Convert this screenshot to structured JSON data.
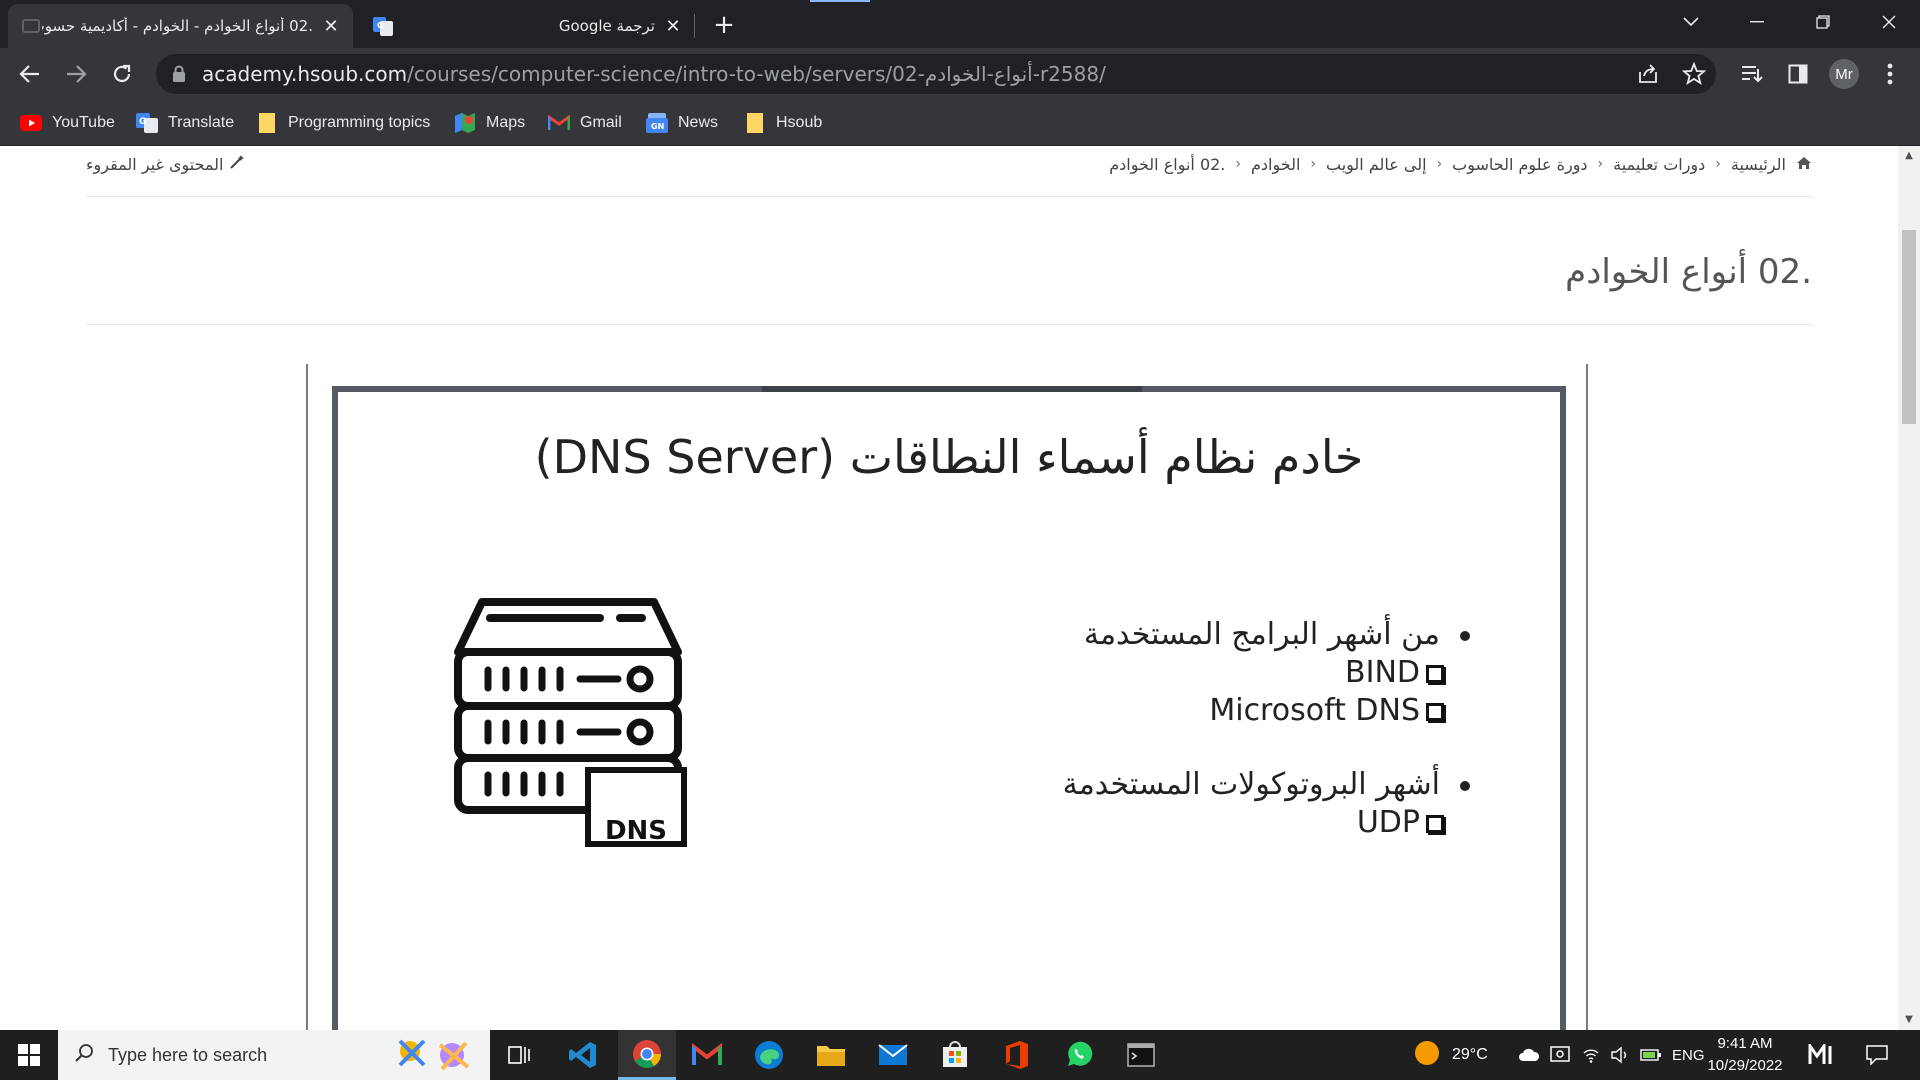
{
  "browser": {
    "tabs": [
      {
        "title": ".02 أنواع الخوادم - الخوادم - أكاديمية حسوب",
        "active": true
      },
      {
        "title": "ترجمة Google",
        "active": false
      }
    ],
    "url_host": "academy.hsoub.com",
    "url_path": "/courses/computer-science/intro-to-web/servers/02-أنواع-الخوادم-r2588/",
    "profile_initials": "Mr",
    "bookmarks": [
      {
        "label": "YouTube",
        "icon": "youtube-icon"
      },
      {
        "label": "Translate",
        "icon": "translate-icon"
      },
      {
        "label": "Programming topics",
        "icon": "folder-icon"
      },
      {
        "label": "Maps",
        "icon": "maps-icon"
      },
      {
        "label": "Gmail",
        "icon": "gmail-icon"
      },
      {
        "label": "News",
        "icon": "news-icon"
      },
      {
        "label": "Hsoub",
        "icon": "folder-icon"
      }
    ]
  },
  "page": {
    "breadcrumb": [
      "الرئيسية",
      "دورات تعليمية",
      "دورة علوم الحاسوب",
      "إلى عالم الويب",
      "الخوادم",
      ".02 أنواع الخوادم"
    ],
    "unread_label": "المحتوى غير المقروء",
    "title": ".02 أنواع الخوادم",
    "slide": {
      "title": "خادم نظام أسماء النطاقات (DNS Server)",
      "image_label": "DNS",
      "groups": [
        {
          "heading": "من أشهر البرامج المستخدمة",
          "items": [
            "BIND",
            "Microsoft DNS"
          ]
        },
        {
          "heading": "أشهر البروتوكولات المستخدمة",
          "items": [
            "UDP"
          ]
        }
      ]
    }
  },
  "taskbar": {
    "search_placeholder": "Type here to search",
    "weather": "29°C",
    "language": "ENG",
    "time": "9:41 AM",
    "date": "10/29/2022"
  },
  "colors": {
    "chrome_dark": "#202124",
    "chrome_toolbar": "#35363a",
    "slide_border": "#555a64"
  }
}
